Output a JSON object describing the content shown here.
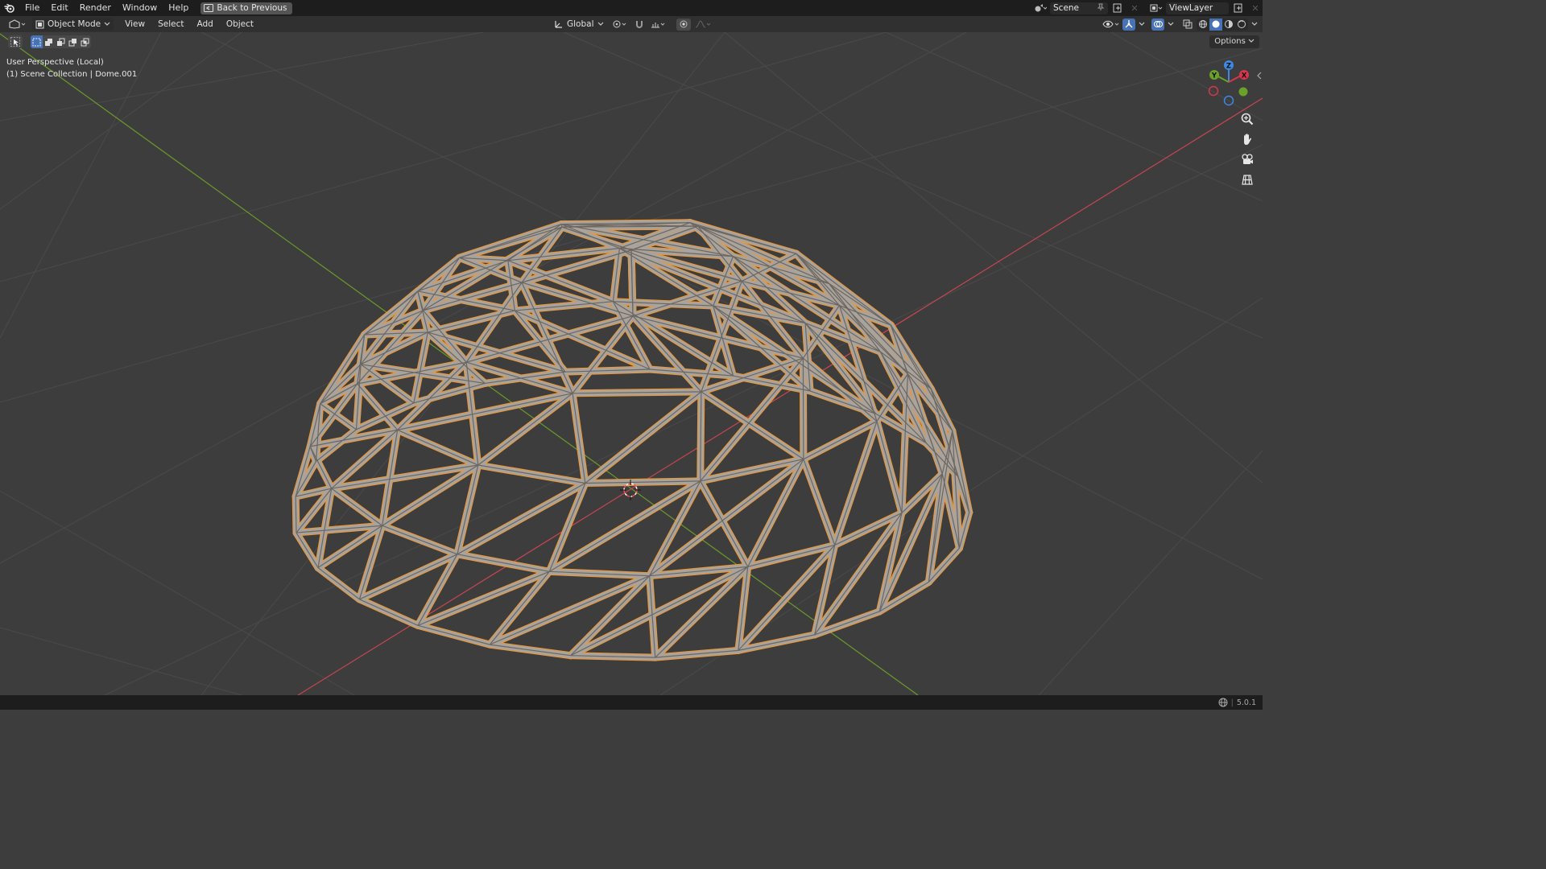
{
  "topbar": {
    "menus": [
      "File",
      "Edit",
      "Render",
      "Window",
      "Help"
    ],
    "back_button": "Back to Previous",
    "scene": "Scene",
    "view_layer": "ViewLayer"
  },
  "header": {
    "mode": "Object Mode",
    "menus": [
      "View",
      "Select",
      "Add",
      "Object"
    ],
    "transform_orientation": "Global",
    "options": "Options"
  },
  "viewport": {
    "perspective": "User Perspective (Local)",
    "collection": "(1) Scene Collection | Dome.001"
  },
  "gizmo": {
    "x": "X",
    "y": "Y",
    "z": "Z"
  },
  "colors": {
    "selection_outline": "#f0962e",
    "x_axis": "#d9364a",
    "y_axis": "#6aa12a",
    "z_axis": "#3d89e3",
    "active_tool": "#4772b3"
  },
  "statusbar": {
    "version": "5.0.1"
  }
}
